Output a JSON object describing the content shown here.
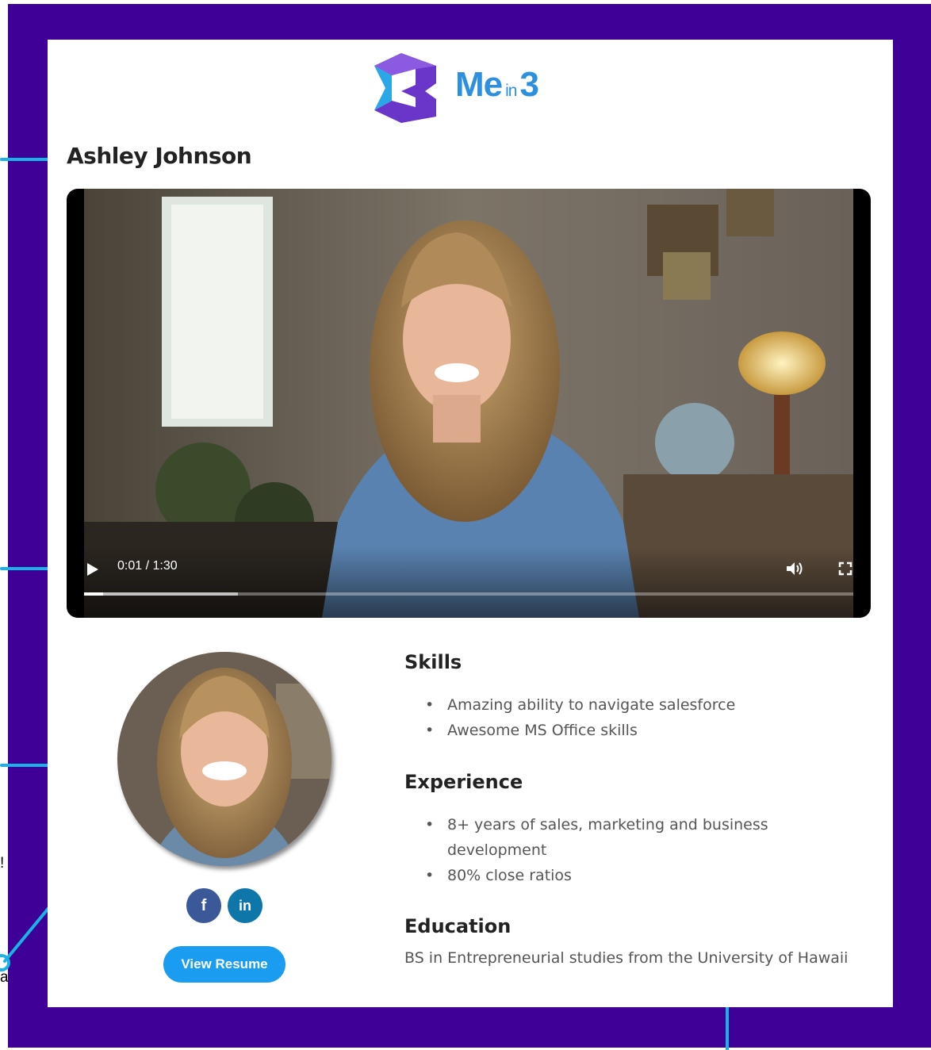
{
  "logo": {
    "brand": "Me",
    "brand_small": "in",
    "brand_number": "3",
    "accent": "#2d8fe0",
    "mark_purple": "#5b2fb8"
  },
  "profile": {
    "name": "Ashley Johnson"
  },
  "video": {
    "time_display": "0:01 / 1:30",
    "progress_fraction": 0.011,
    "buffered_fraction": 0.2,
    "play_icon": "play-icon",
    "volume_icon": "volume-icon",
    "fullscreen_icon": "fullscreen-icon"
  },
  "social": {
    "facebook_label": "f",
    "linkedin_label": "in"
  },
  "actions": {
    "view_resume": "View Resume"
  },
  "skills": {
    "title": "Skills",
    "items": [
      "Amazing ability to navigate salesforce",
      "Awesome MS Office skills"
    ]
  },
  "experience": {
    "title": "Experience",
    "items": [
      "8+ years of sales, marketing and business development",
      "80% close ratios"
    ]
  },
  "education": {
    "title": "Education",
    "text": "BS in Entrepreneurial studies from the University of Hawaii"
  },
  "annotations": {
    "fragment_1": "!",
    "fragment_2": "a"
  },
  "colors": {
    "frame": "#3e0096",
    "annotation": "#1bb3e6",
    "button": "#1a9cf0"
  }
}
